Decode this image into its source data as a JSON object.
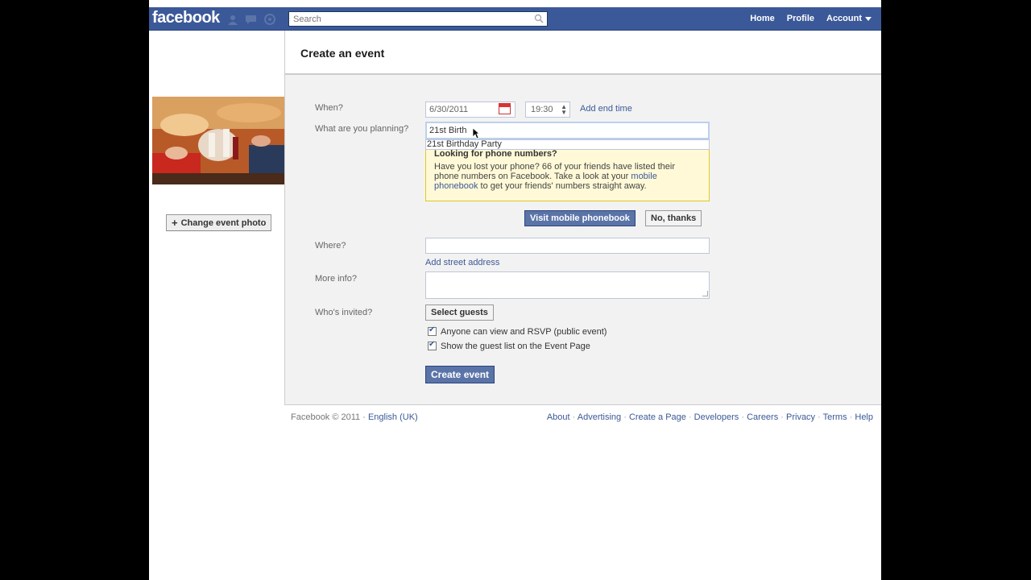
{
  "topbar": {
    "logo": "facebook",
    "search_placeholder": "Search",
    "nav": {
      "home": "Home",
      "profile": "Profile",
      "account": "Account"
    }
  },
  "sidebar": {
    "change_photo_label": "Change event photo"
  },
  "main": {
    "title": "Create an event",
    "when_label": "When?",
    "date_value": "6/30/2011",
    "time_value": "19:30",
    "add_end_time": "Add end time",
    "plan_label": "What are you planning?",
    "plan_value": "21st Birth",
    "suggestion": "21st Birthday Party",
    "tip": {
      "title": "Looking for phone numbers?",
      "text_before": "Have you lost your phone? 66 of your friends have listed their phone numbers on Facebook. Take a look at your ",
      "link": "mobile phonebook",
      "text_after": " to get your friends' numbers straight away."
    },
    "visit_button": "Visit mobile phonebook",
    "no_thanks_button": "No, thanks",
    "where_label": "Where?",
    "add_address": "Add street address",
    "more_info_label": "More info?",
    "invited_label": "Who's invited?",
    "select_guests": "Select guests",
    "check_public": "Anyone can view and RSVP (public event)",
    "check_guestlist": "Show the guest list on the Event Page",
    "create_button": "Create event"
  },
  "footer": {
    "copyright": "Facebook © 2011 ·",
    "language": "English (UK)",
    "links": [
      "About",
      "Advertising",
      "Create a Page",
      "Developers",
      "Careers",
      "Privacy",
      "Terms",
      "Help"
    ]
  },
  "colors": {
    "brand": "#3b5998",
    "tip_bg": "#fff9d7",
    "form_bg": "#f2f2f2"
  }
}
